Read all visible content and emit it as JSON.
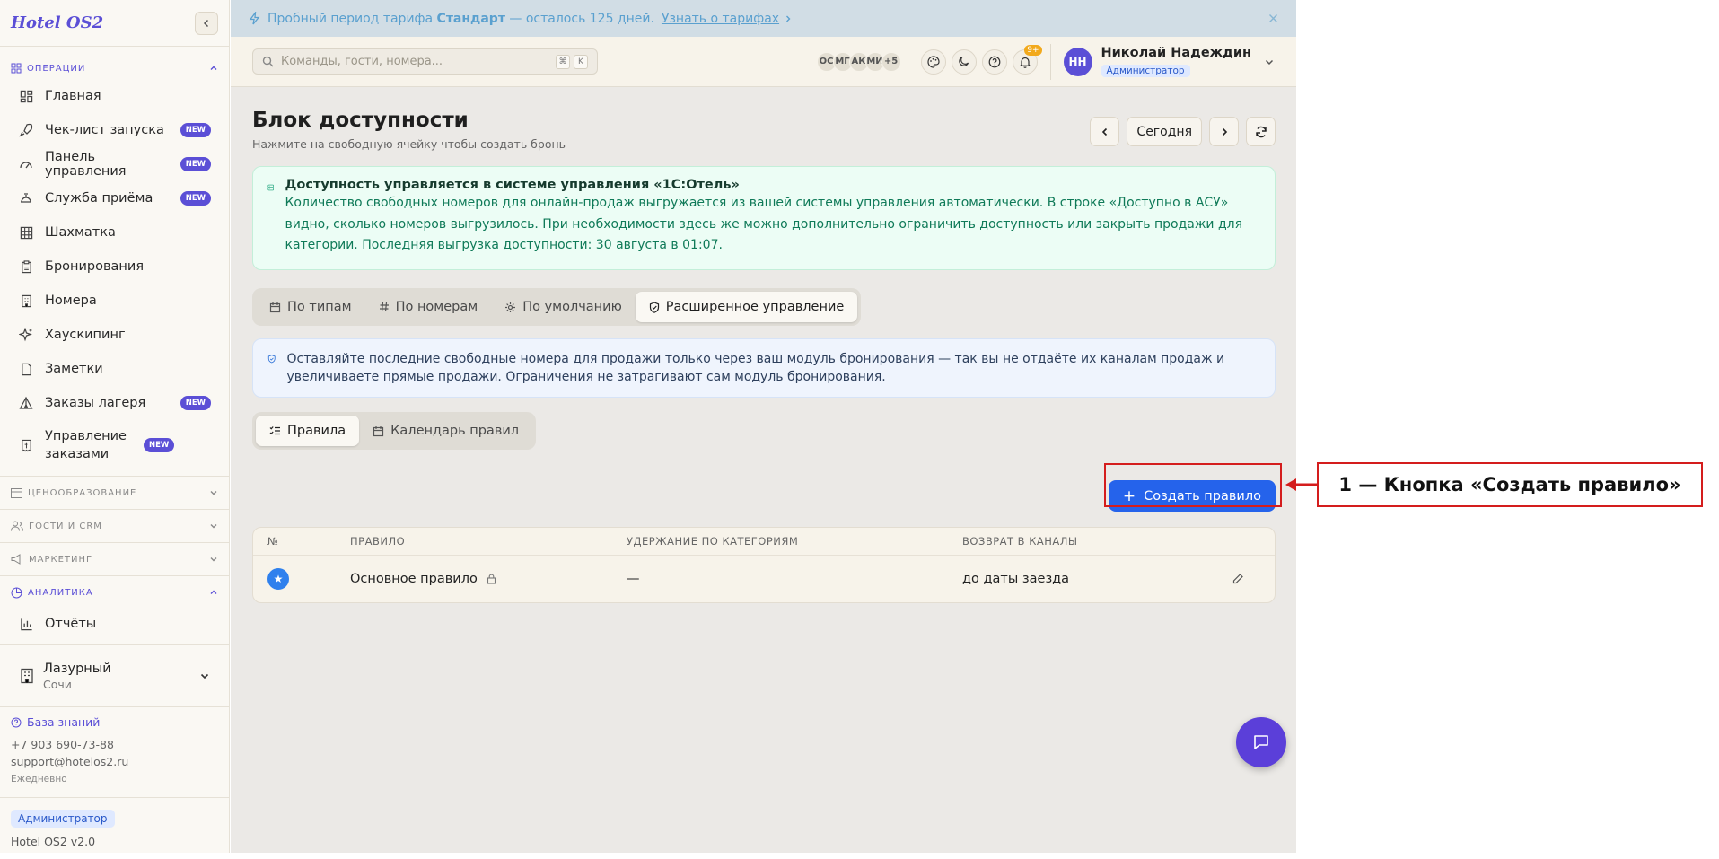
{
  "app": {
    "logo": "Hotel OS2"
  },
  "sidebar": {
    "sec_ops": "ОПЕРАЦИИ",
    "items": [
      {
        "label": "Главная",
        "icon": "dashboard-icon"
      },
      {
        "label": "Чек-лист запуска",
        "icon": "rocket-icon",
        "badge": "NEW"
      },
      {
        "label": "Панель управления",
        "icon": "gauge-icon",
        "badge": "NEW"
      },
      {
        "label": "Служба приёма",
        "icon": "bell-icon",
        "badge": "NEW"
      },
      {
        "label": "Шахматка",
        "icon": "grid-icon"
      },
      {
        "label": "Бронирования",
        "icon": "clipboard-icon"
      },
      {
        "label": "Номера",
        "icon": "building-icon"
      },
      {
        "label": "Хаускипинг",
        "icon": "sparkles-icon"
      },
      {
        "label": "Заметки",
        "icon": "note-icon"
      },
      {
        "label": "Заказы лагеря",
        "icon": "tent-icon",
        "badge": "NEW"
      },
      {
        "label": "Управление заказами",
        "icon": "receipt-icon",
        "badge": "NEW"
      }
    ],
    "sec_pricing": "ЦЕНООБРАЗОВАНИЕ",
    "sec_guests": "ГОСТИ И CRM",
    "sec_marketing": "МАРКЕТИНГ",
    "sec_analytics": "АНАЛИТИКА",
    "reports": "Отчёты",
    "hotel": {
      "name": "Лазурный",
      "city": "Сочи"
    },
    "support": {
      "kb": "База знаний",
      "phone": "+7 903 690-73-88",
      "email": "support@hotelos2.ru",
      "hours": "Ежедневно"
    },
    "role": "Администратор",
    "version": "Hotel OS2 v2.0"
  },
  "trial": {
    "prefix": "Пробный период тарифа",
    "plan": "Стандарт",
    "suffix": "— осталось 125 дней.",
    "link": "Узнать о тарифах"
  },
  "topbar": {
    "search_placeholder": "Команды, гости, номера...",
    "kbd1": "⌘",
    "kbd2": "K",
    "avatars": [
      "ОС",
      "МГ",
      "АК",
      "МИ",
      "+5"
    ],
    "notif_count": "9+",
    "user": {
      "initials": "НН",
      "name": "Николай Надеждин",
      "role": "Администратор"
    }
  },
  "page": {
    "title": "Блок доступности",
    "subtitle": "Нажмите на свободную ячейку чтобы создать бронь",
    "today": "Сегодня"
  },
  "info1": {
    "title": "Доступность управляется в системе управления «1С:Отель»",
    "text": "Количество свободных номеров для онлайн-продаж выгружается из вашей системы управления автоматически. В строке «Доступно в АСУ» видно, сколько номеров выгрузилось. При необходимости здесь же можно дополнительно ограничить доступность или закрыть продажи для категории. Последняя выгрузка доступности: 30 августа в 01:07."
  },
  "tabs": [
    {
      "label": "По типам",
      "icon": "calendar-icon"
    },
    {
      "label": "По номерам",
      "icon": "hash-icon"
    },
    {
      "label": "По умолчанию",
      "icon": "gear-icon"
    },
    {
      "label": "Расширенное управление",
      "icon": "shield-icon",
      "active": true
    }
  ],
  "info2": {
    "text": "Оставляйте последние свободные номера для продажи только через ваш модуль бронирования — так вы не отдаёте их каналам продаж и увеличиваете прямые продажи. Ограничения не затрагивают сам модуль бронирования."
  },
  "subtabs": [
    {
      "label": "Правила",
      "icon": "list-check-icon",
      "active": true
    },
    {
      "label": "Календарь правил",
      "icon": "calendar-icon"
    }
  ],
  "create_button": "Создать правило",
  "table": {
    "headers": [
      "№",
      "ПРАВИЛО",
      "УДЕРЖАНИЕ ПО КАТЕГОРИЯМ",
      "ВОЗВРАТ В КАНАЛЫ"
    ],
    "rows": [
      {
        "rule": "Основное правило",
        "hold": "—",
        "return": "до даты заезда"
      }
    ]
  },
  "callout": "1 — Кнопка «Создать правило»",
  "colors": {
    "accent": "#5b4fd6",
    "primary": "#2563eb",
    "highlight": "#d41d1d"
  }
}
